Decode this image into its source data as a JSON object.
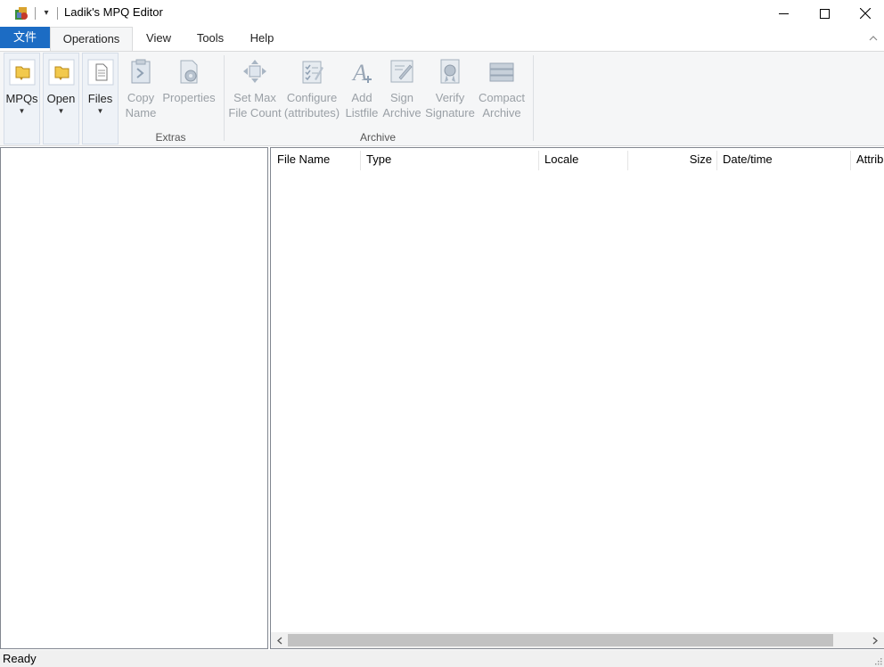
{
  "window": {
    "title": "Ladik's MPQ Editor",
    "qa_dropdown": "▾"
  },
  "tabs": {
    "file": "文件",
    "operations": "Operations",
    "view": "View",
    "tools": "Tools",
    "help": "Help"
  },
  "ribbon": {
    "mpqs": "MPQs",
    "open": "Open",
    "files": "Files",
    "copy_name": [
      "Copy",
      "Name"
    ],
    "properties": "Properties",
    "set_max_file_count": [
      "Set Max",
      "File Count"
    ],
    "configure_attributes": [
      "Configure",
      "(attributes)"
    ],
    "add_listfile": [
      "Add",
      "Listfile"
    ],
    "sign_archive": [
      "Sign",
      "Archive"
    ],
    "verify_signature": [
      "Verify",
      "Signature"
    ],
    "compact_archive": [
      "Compact",
      "Archive"
    ],
    "groups": {
      "extras": "Extras",
      "archive": "Archive"
    },
    "dropdown_arrow": "▼"
  },
  "file_list": {
    "columns": [
      "File Name",
      "Type",
      "Locale",
      "Size",
      "Date/time",
      "Attrib"
    ]
  },
  "status": {
    "text": "Ready"
  },
  "colors": {
    "file_tab": "#1c6cc4",
    "ribbon_bg": "#f5f6f7",
    "disabled_text": "#9aa0a6"
  }
}
